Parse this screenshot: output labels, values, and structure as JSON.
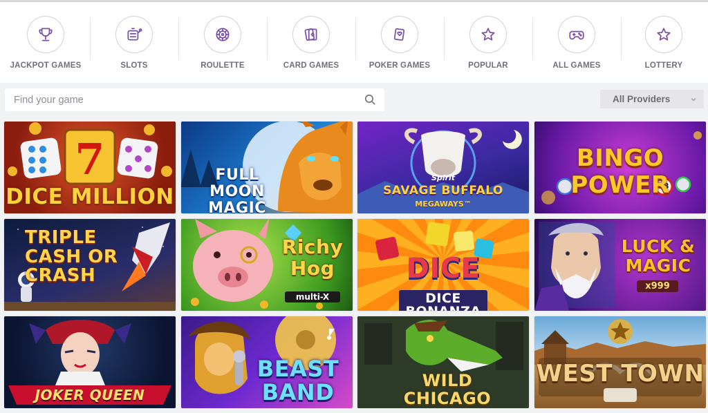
{
  "categories": [
    {
      "label": "JACKPOT GAMES",
      "icon": "trophy-icon"
    },
    {
      "label": "SLOTS",
      "icon": "slot-machine-icon"
    },
    {
      "label": "ROULETTE",
      "icon": "roulette-icon"
    },
    {
      "label": "CARD GAMES",
      "icon": "cards-icon"
    },
    {
      "label": "POKER GAMES",
      "icon": "poker-card-icon"
    },
    {
      "label": "POPULAR",
      "icon": "star-icon"
    },
    {
      "label": "ALL GAMES",
      "icon": "gamepad-icon"
    },
    {
      "label": "LOTTERY",
      "icon": "star-icon"
    }
  ],
  "search": {
    "placeholder": "Find your game"
  },
  "providers": {
    "selected": "All Providers"
  },
  "games": [
    {
      "title": "DICE MILLION",
      "subtitle": ""
    },
    {
      "title": "FULL MOON MAGIC",
      "subtitle": ""
    },
    {
      "title": "SAVAGE BUFFALO",
      "subtitle": "MEGAWAYS™",
      "badge": "Spirit"
    },
    {
      "title": "BINGO POWER",
      "subtitle": "",
      "ball": "53"
    },
    {
      "title": "TRIPLE CASH OR CRASH",
      "subtitle": ""
    },
    {
      "title": "Richy Hog",
      "subtitle": "multi-X"
    },
    {
      "title": "DICE BONANZA",
      "subtitle": ""
    },
    {
      "title": "LUCK & MAGIC",
      "subtitle": "x999"
    },
    {
      "title": "JOKER QUEEN",
      "subtitle": ""
    },
    {
      "title": "BEAST BAND",
      "subtitle": ""
    },
    {
      "title": "WILD CHICAGO",
      "subtitle": ""
    },
    {
      "title": "WEST TOWN",
      "subtitle": ""
    }
  ],
  "colors": {
    "accent": "#7a4fa8",
    "text_muted": "#6f6f7a"
  }
}
